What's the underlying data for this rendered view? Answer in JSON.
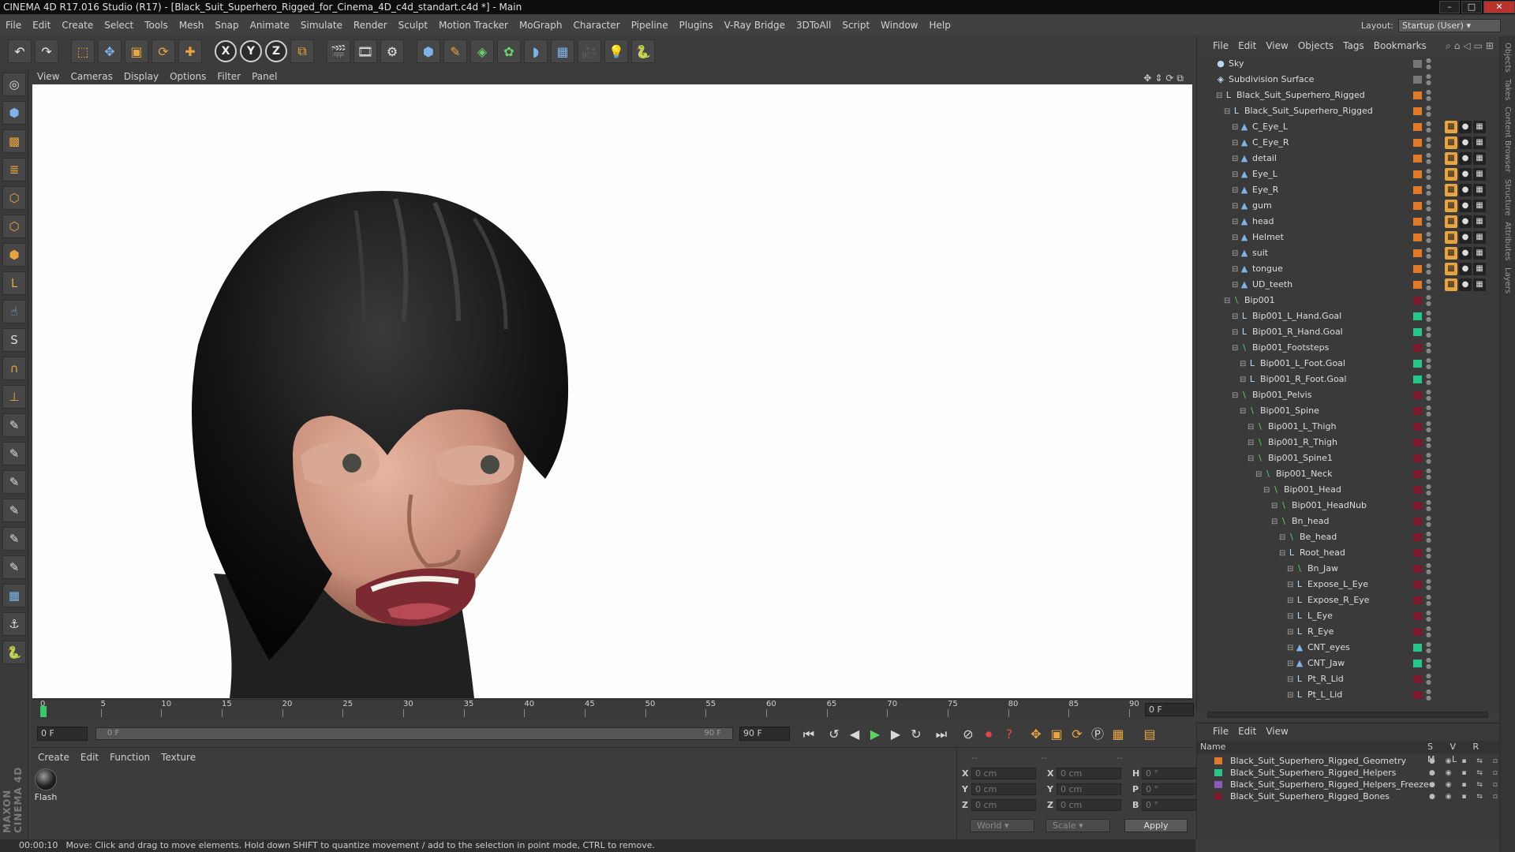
{
  "window": {
    "title": "CINEMA 4D R17.016 Studio (R17) - [Black_Suit_Superhero_Rigged_for_Cinema_4D_c4d_standart.c4d *] - Main"
  },
  "menubar": [
    "File",
    "Edit",
    "Create",
    "Select",
    "Tools",
    "Mesh",
    "Snap",
    "Animate",
    "Simulate",
    "Render",
    "Sculpt",
    "Motion Tracker",
    "MoGraph",
    "Character",
    "Pipeline",
    "Plugins",
    "V-Ray Bridge",
    "3DToAll",
    "Script",
    "Window",
    "Help"
  ],
  "layout": {
    "label": "Layout:",
    "value": "Startup (User)"
  },
  "toolbar": {
    "axis_x": "X",
    "axis_y": "Y",
    "axis_z": "Z"
  },
  "viewport": {
    "menu": [
      "View",
      "Cameras",
      "Display",
      "Options",
      "Filter",
      "Panel"
    ]
  },
  "timeline": {
    "ticks": [
      "0",
      "5",
      "10",
      "15",
      "20",
      "25",
      "30",
      "35",
      "40",
      "45",
      "50",
      "55",
      "60",
      "65",
      "70",
      "75",
      "80",
      "85",
      "90"
    ],
    "current": "0 F"
  },
  "transport": {
    "start": "0 F",
    "range_start": "0 F",
    "range_end": "90 F",
    "end": "90 F"
  },
  "material_manager": {
    "menu": [
      "Create",
      "Edit",
      "Function",
      "Texture"
    ],
    "materials": [
      {
        "name": "Flash"
      }
    ]
  },
  "coordinates": {
    "headers": [
      "--",
      "--",
      "--"
    ],
    "rows": [
      {
        "a": "X",
        "av": "0 cm",
        "b": "X",
        "bv": "0 cm",
        "c": "H",
        "cv": "0 °"
      },
      {
        "a": "Y",
        "av": "0 cm",
        "b": "Y",
        "bv": "0 cm",
        "c": "P",
        "cv": "0 °"
      },
      {
        "a": "Z",
        "av": "0 cm",
        "b": "Z",
        "bv": "0 cm",
        "c": "B",
        "cv": "0 °"
      }
    ],
    "space": "World",
    "mode": "Scale",
    "apply": "Apply"
  },
  "status": {
    "time": "00:00:10",
    "message": "Move: Click and drag to move elements. Hold down SHIFT to quantize movement / add to the selection in point mode, CTRL to remove."
  },
  "object_manager": {
    "menu": [
      "File",
      "Edit",
      "View",
      "Objects",
      "Tags",
      "Bookmarks"
    ],
    "items": [
      {
        "name": "Sky",
        "depth": 0,
        "icon": "●",
        "layer": "w"
      },
      {
        "name": "Subdivision Surface",
        "depth": 0,
        "icon": "◈",
        "layer": "w"
      },
      {
        "name": "Black_Suit_Superhero_Rigged",
        "depth": 1,
        "icon": "L",
        "layer": "o"
      },
      {
        "name": "Black_Suit_Superhero_Rigged",
        "depth": 2,
        "icon": "L",
        "layer": "o"
      },
      {
        "name": "C_Eye_L",
        "depth": 3,
        "icon": "▲",
        "layer": "o",
        "tags": true
      },
      {
        "name": "C_Eye_R",
        "depth": 3,
        "icon": "▲",
        "layer": "o",
        "tags": true
      },
      {
        "name": "detail",
        "depth": 3,
        "icon": "▲",
        "layer": "o",
        "tags": true
      },
      {
        "name": "Eye_L",
        "depth": 3,
        "icon": "▲",
        "layer": "o",
        "tags": true
      },
      {
        "name": "Eye_R",
        "depth": 3,
        "icon": "▲",
        "layer": "o",
        "tags": true
      },
      {
        "name": "gum",
        "depth": 3,
        "icon": "▲",
        "layer": "o",
        "tags": true
      },
      {
        "name": "head",
        "depth": 3,
        "icon": "▲",
        "layer": "o",
        "tags": true
      },
      {
        "name": "Helmet",
        "depth": 3,
        "icon": "▲",
        "layer": "o",
        "tags": true
      },
      {
        "name": "suit",
        "depth": 3,
        "icon": "▲",
        "layer": "o",
        "tags": true
      },
      {
        "name": "tongue",
        "depth": 3,
        "icon": "▲",
        "layer": "o",
        "tags": true
      },
      {
        "name": "UD_teeth",
        "depth": 3,
        "icon": "▲",
        "layer": "o",
        "tags": true
      },
      {
        "name": "Bip001",
        "depth": 2,
        "icon": "\\",
        "layer": "r"
      },
      {
        "name": "Bip001_L_Hand.Goal",
        "depth": 3,
        "icon": "L",
        "layer": "g"
      },
      {
        "name": "Bip001_R_Hand.Goal",
        "depth": 3,
        "icon": "L",
        "layer": "g"
      },
      {
        "name": "Bip001_Footsteps",
        "depth": 3,
        "icon": "\\",
        "layer": "r"
      },
      {
        "name": "Bip001_L_Foot.Goal",
        "depth": 4,
        "icon": "L",
        "layer": "g"
      },
      {
        "name": "Bip001_R_Foot.Goal",
        "depth": 4,
        "icon": "L",
        "layer": "g"
      },
      {
        "name": "Bip001_Pelvis",
        "depth": 3,
        "icon": "\\",
        "layer": "r"
      },
      {
        "name": "Bip001_Spine",
        "depth": 4,
        "icon": "\\",
        "layer": "r"
      },
      {
        "name": "Bip001_L_Thigh",
        "depth": 5,
        "icon": "\\",
        "layer": "r"
      },
      {
        "name": "Bip001_R_Thigh",
        "depth": 5,
        "icon": "\\",
        "layer": "r"
      },
      {
        "name": "Bip001_Spine1",
        "depth": 5,
        "icon": "\\",
        "layer": "r"
      },
      {
        "name": "Bip001_Neck",
        "depth": 6,
        "icon": "\\",
        "layer": "r"
      },
      {
        "name": "Bip001_Head",
        "depth": 7,
        "icon": "\\",
        "layer": "r"
      },
      {
        "name": "Bip001_HeadNub",
        "depth": 8,
        "icon": "\\",
        "layer": "r"
      },
      {
        "name": "Bn_head",
        "depth": 8,
        "icon": "\\",
        "layer": "r"
      },
      {
        "name": "Be_head",
        "depth": 9,
        "icon": "\\",
        "layer": "r"
      },
      {
        "name": "Root_head",
        "depth": 9,
        "icon": "L",
        "layer": "r"
      },
      {
        "name": "Bn_Jaw",
        "depth": 10,
        "icon": "\\",
        "layer": "r"
      },
      {
        "name": "Expose_L_Eye",
        "depth": 10,
        "icon": "L",
        "layer": "r"
      },
      {
        "name": "Expose_R_Eye",
        "depth": 10,
        "icon": "L",
        "layer": "r"
      },
      {
        "name": "L_Eye",
        "depth": 10,
        "icon": "L",
        "layer": "r"
      },
      {
        "name": "R_Eye",
        "depth": 10,
        "icon": "L",
        "layer": "r"
      },
      {
        "name": "CNT_eyes",
        "depth": 10,
        "icon": "▲",
        "layer": "g"
      },
      {
        "name": "CNT_Jaw",
        "depth": 10,
        "icon": "▲",
        "layer": "g"
      },
      {
        "name": "Pt_R_Lid",
        "depth": 10,
        "icon": "L",
        "layer": "r"
      },
      {
        "name": "Pt_L_Lid",
        "depth": 10,
        "icon": "L",
        "layer": "r"
      }
    ]
  },
  "layer_manager": {
    "menu": [
      "File",
      "Edit",
      "View"
    ],
    "header_name": "Name",
    "header_cols": "S V R M L",
    "layers": [
      {
        "name": "Black_Suit_Superhero_Rigged_Geometry",
        "color": "#e07a2a"
      },
      {
        "name": "Black_Suit_Superhero_Rigged_Helpers",
        "color": "#29c48a"
      },
      {
        "name": "Black_Suit_Superhero_Rigged_Helpers_Freeze",
        "color": "#8c5ab4"
      },
      {
        "name": "Black_Suit_Superhero_Rigged_Bones",
        "color": "#7a1a2a"
      }
    ]
  },
  "side_tabs": [
    "Objects",
    "Takes",
    "Content Browser",
    "Structure",
    "Attributes",
    "Layers"
  ]
}
